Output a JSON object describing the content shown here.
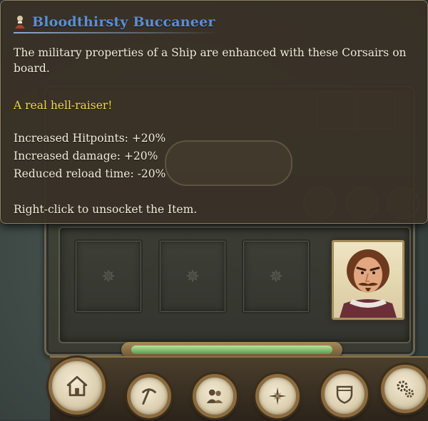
{
  "tooltip": {
    "title": "Bloodthirsty Buccaneer",
    "description": "The military properties of a Ship are enhanced with these Corsairs on board.",
    "flavor": "A real hell-raiser!",
    "stats": [
      "Increased Hitpoints: +20%",
      "Increased damage: +20%",
      "Reduced reload time: -20%"
    ],
    "hint": "Right-click to unsocket the Item.",
    "title_icon": "person-icon",
    "title_color": "#5b8fd6",
    "flavor_color": "#f0d84a"
  },
  "sockets": {
    "empty_slots": 3,
    "empty_slot_icon": "gear-icon",
    "filled_slot_icon": "buccaneer-portrait"
  },
  "progress": {
    "fraction": 1.0,
    "color": "#7fb86a"
  },
  "nav": {
    "buttons": [
      "home-icon",
      "pickaxe-icon",
      "population-icon",
      "compass-icon",
      "shield-icon",
      "settings-icon"
    ]
  }
}
